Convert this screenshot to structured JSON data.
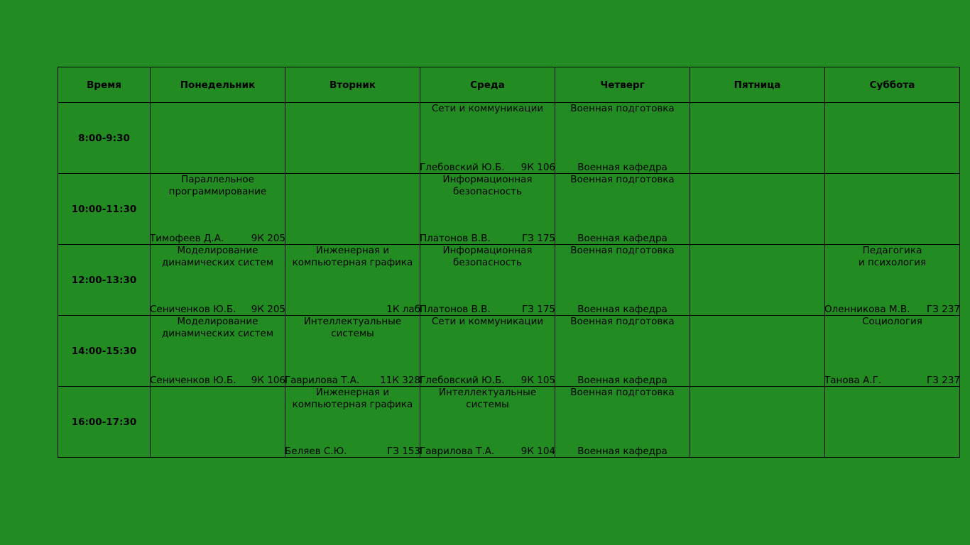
{
  "colors": {
    "background": "#228b22",
    "grid_lines": "#000000"
  },
  "headers": [
    "Время",
    "Понедельник",
    "Вторник",
    "Среда",
    "Четверг",
    "Пятница",
    "Суббота"
  ],
  "rows": [
    {
      "time": "8:00-9:30",
      "cells": [
        {
          "subject": "",
          "teacher": "",
          "room": ""
        },
        {
          "subject": "",
          "teacher": "",
          "room": ""
        },
        {
          "subject": "Сети и коммуникации",
          "teacher": "Глебовский Ю.Б.",
          "room": "9К 106"
        },
        {
          "subject": "Военная подготовка",
          "teacher": "Военная кафедра",
          "room": ""
        },
        {
          "subject": "",
          "teacher": "",
          "room": ""
        },
        {
          "subject": "",
          "teacher": "",
          "room": ""
        }
      ]
    },
    {
      "time": "10:00-11:30",
      "cells": [
        {
          "subject": "Параллельное\nпрограммирование",
          "teacher": "Тимофеев Д.А.",
          "room": "9К 205"
        },
        {
          "subject": "",
          "teacher": "",
          "room": ""
        },
        {
          "subject": "Информационная\nбезопасность",
          "teacher": "Платонов В.В.",
          "room": "ГЗ 175"
        },
        {
          "subject": "Военная подготовка",
          "teacher": "Военная кафедра",
          "room": ""
        },
        {
          "subject": "",
          "teacher": "",
          "room": ""
        },
        {
          "subject": "",
          "teacher": "",
          "room": ""
        }
      ]
    },
    {
      "time": "12:00-13:30",
      "cells": [
        {
          "subject": "Моделирование\nдинамических систем",
          "teacher": "Сениченков Ю.Б.",
          "room": "9К 205"
        },
        {
          "subject": "Инженерная и\nкомпьютерная графика",
          "teacher": "",
          "room": "1К лаб"
        },
        {
          "subject": "Информационная\nбезопасность",
          "teacher": "Платонов В.В.",
          "room": "ГЗ 175"
        },
        {
          "subject": "Военная подготовка",
          "teacher": "Военная кафедра",
          "room": ""
        },
        {
          "subject": "",
          "teacher": "",
          "room": ""
        },
        {
          "subject": "Педагогика\nи психология",
          "teacher": "Оленникова М.В.",
          "room": "ГЗ 237"
        }
      ]
    },
    {
      "time": "14:00-15:30",
      "cells": [
        {
          "subject": "Моделирование\nдинамических систем",
          "teacher": "Сениченков Ю.Б.",
          "room": "9К 106"
        },
        {
          "subject": "Интеллектуальные\nсистемы",
          "teacher": "Гаврилова Т.А.",
          "room": "11К 328"
        },
        {
          "subject": "Сети и коммуникации",
          "teacher": "Глебовский Ю.Б.",
          "room": "9К 105"
        },
        {
          "subject": "Военная подготовка",
          "teacher": "Военная кафедра",
          "room": ""
        },
        {
          "subject": "",
          "teacher": "",
          "room": ""
        },
        {
          "subject": "Социология",
          "teacher": "Танова А.Г.",
          "room": "ГЗ 237"
        }
      ]
    },
    {
      "time": "16:00-17:30",
      "cells": [
        {
          "subject": "",
          "teacher": "",
          "room": ""
        },
        {
          "subject": "Инженерная и\nкомпьютерная графика",
          "teacher": "Беляев С.Ю.",
          "room": "ГЗ 153"
        },
        {
          "subject": "Интеллектуальные\nсистемы",
          "teacher": "Гаврилова Т.А.",
          "room": "9К 104"
        },
        {
          "subject": "Военная подготовка",
          "teacher": "Военная кафедра",
          "room": ""
        },
        {
          "subject": "",
          "teacher": "",
          "room": ""
        },
        {
          "subject": "",
          "teacher": "",
          "room": ""
        }
      ]
    }
  ]
}
